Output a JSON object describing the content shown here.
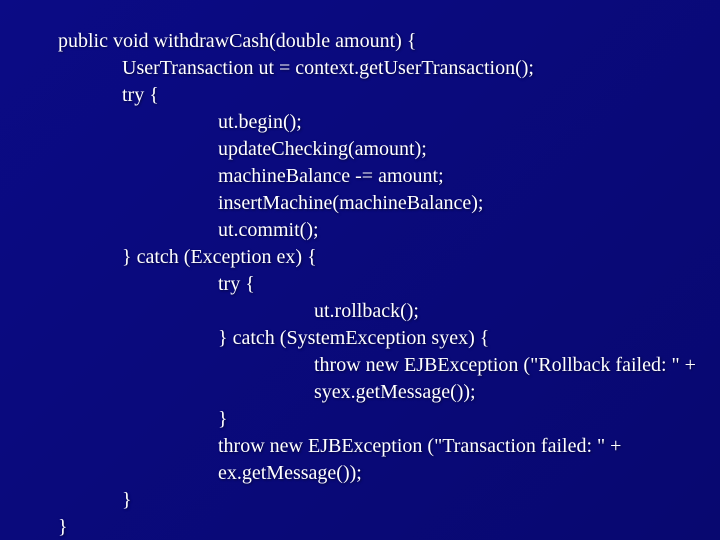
{
  "code": {
    "l0": "public void withdrawCash(double amount) {",
    "l1": "UserTransaction ut = context.getUserTransaction();",
    "l2": "try {",
    "l3": "ut.begin();",
    "l4": "updateChecking(amount);",
    "l5": "machineBalance -= amount;",
    "l6": "insertMachine(machineBalance);",
    "l7": "ut.commit();",
    "l8": "} catch (Exception ex) {",
    "l9": "try {",
    "l10": "ut.rollback();",
    "l11": "} catch (SystemException syex) {",
    "l12": "throw new EJBException (\"Rollback failed: \" +",
    "l13": "syex.getMessage());",
    "l14": "}",
    "l15": "throw new EJBException (\"Transaction failed: \" +",
    "l16": "ex.getMessage());",
    "l17": "}",
    "l18": "}"
  }
}
